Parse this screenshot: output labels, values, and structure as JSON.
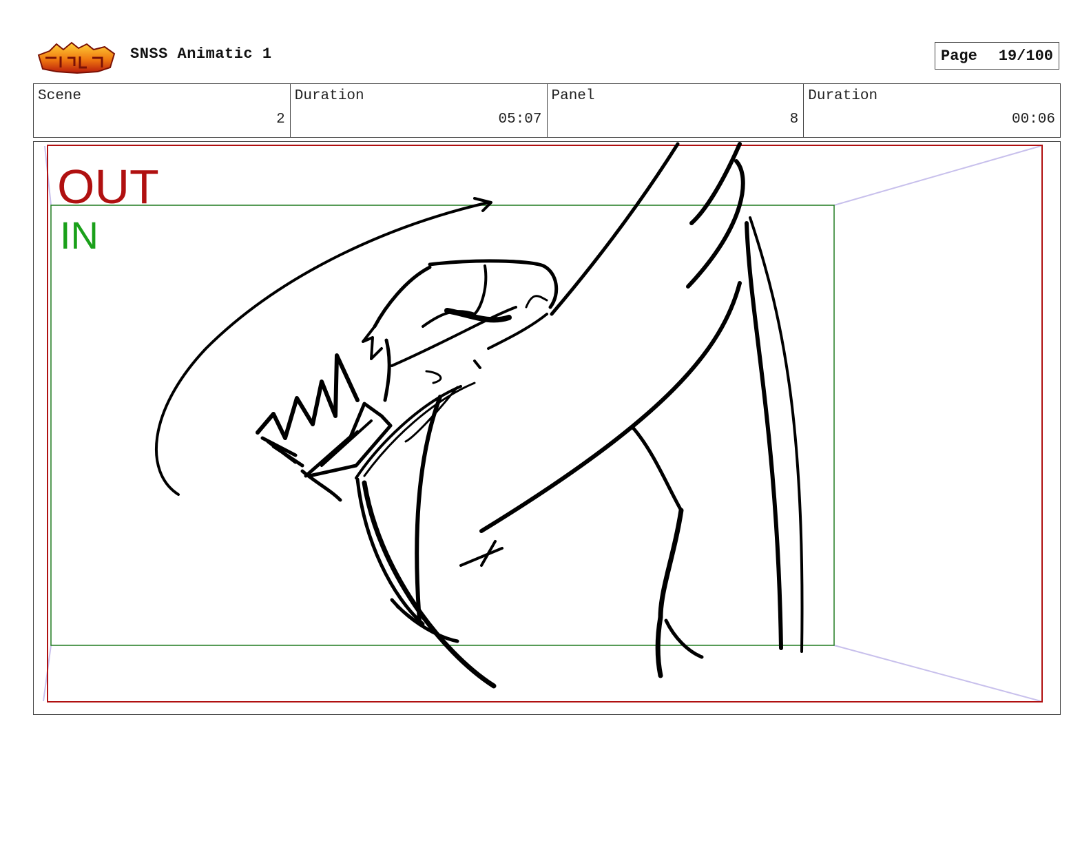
{
  "header": {
    "title": "SNSS Animatic 1",
    "page_label": "Page",
    "page_value": "19/100",
    "logo_icon": "sonic-logo-icon"
  },
  "info": {
    "scene_label": "Scene",
    "scene_value": "2",
    "duration_label": "Duration",
    "duration_value": "05:07",
    "panel_label": "Panel",
    "panel_value": "8",
    "panel_duration_label": "Duration",
    "panel_duration_value": "00:06"
  },
  "frames": {
    "out_label": "OUT",
    "in_label": "IN",
    "out_color": "#b01010",
    "in_color": "#1aa01a",
    "guide_color": "#c8c0ec"
  }
}
